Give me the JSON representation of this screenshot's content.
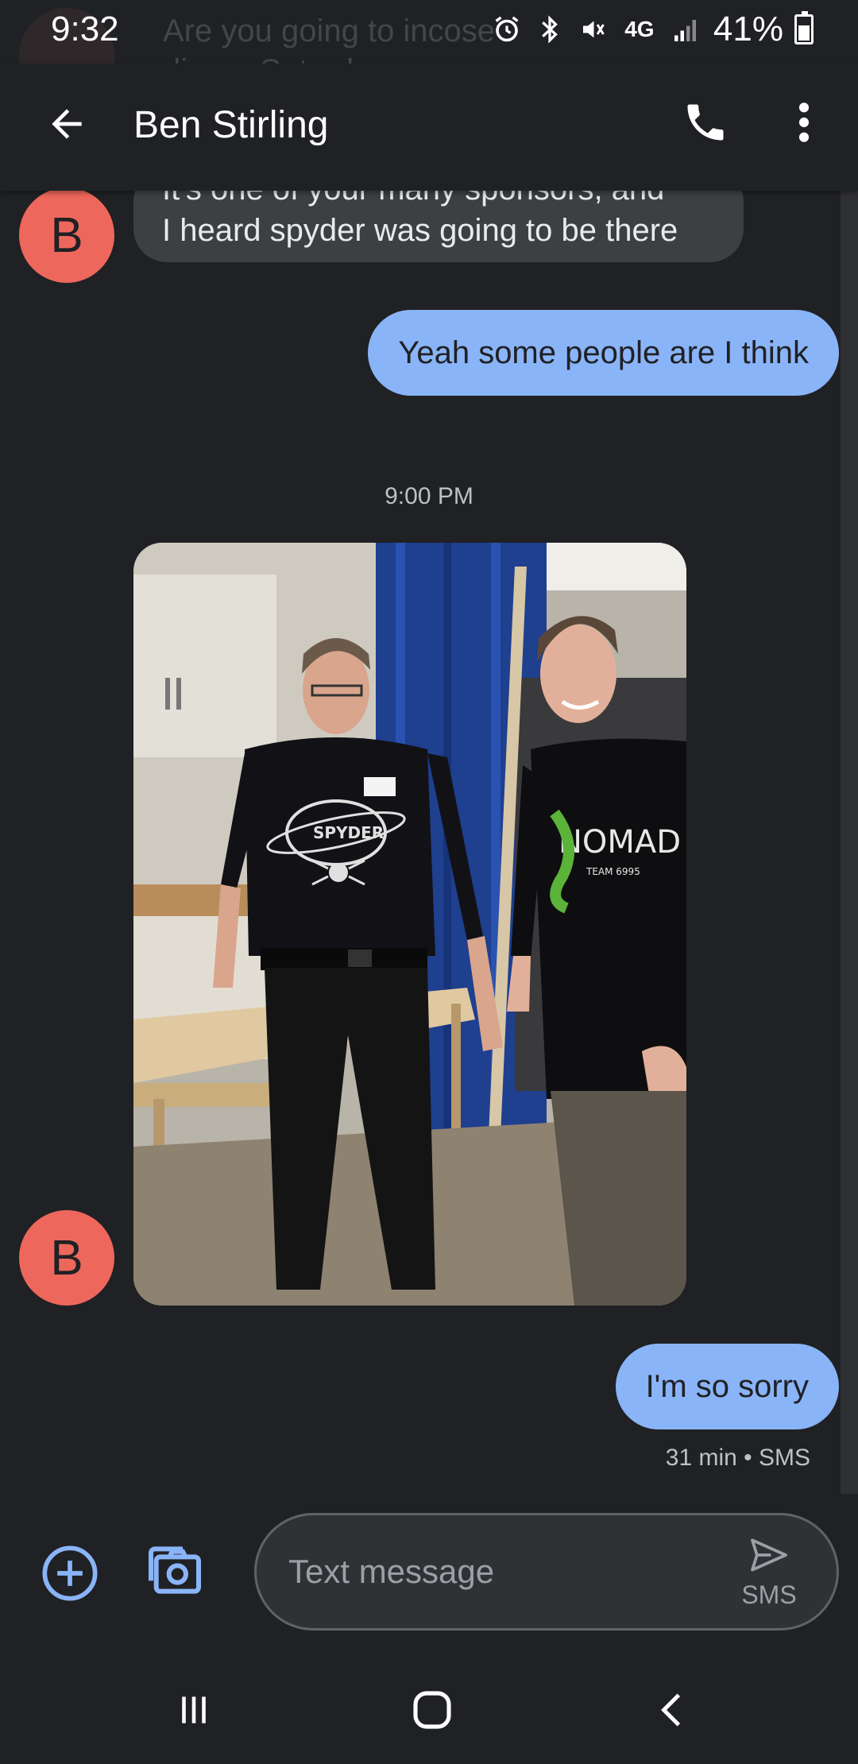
{
  "status_bar": {
    "time": "9:32",
    "network": "4G",
    "battery": "41%"
  },
  "notification_preview": {
    "text_line1": "Are you going to incose",
    "text_line2": "dinner Saturday"
  },
  "app_bar": {
    "title": "Ben Stirling"
  },
  "messages": [
    {
      "direction": "incoming",
      "sender_initial": "B",
      "line1": "It's one of your many sponsors, and",
      "line2": "I heard spyder was going to be there"
    },
    {
      "direction": "outgoing",
      "text": "Yeah some people are I think"
    },
    {
      "type": "timestamp",
      "text": "9:00 PM"
    },
    {
      "direction": "incoming",
      "sender_initial": "B",
      "type": "image",
      "shirt_left": "SPYDER",
      "shirt_right": "NOMAD",
      "shirt_right_sub": "TEAM 6995"
    },
    {
      "direction": "outgoing",
      "text": "I'm so sorry",
      "meta": "31 min • SMS"
    }
  ],
  "compose": {
    "placeholder": "Text message",
    "send_label": "SMS"
  },
  "colors": {
    "background": "#202124",
    "incoming_bubble": "#3c4043",
    "outgoing_bubble": "#8ab4f8",
    "avatar": "#ee675c",
    "accent": "#8ab4f8"
  }
}
